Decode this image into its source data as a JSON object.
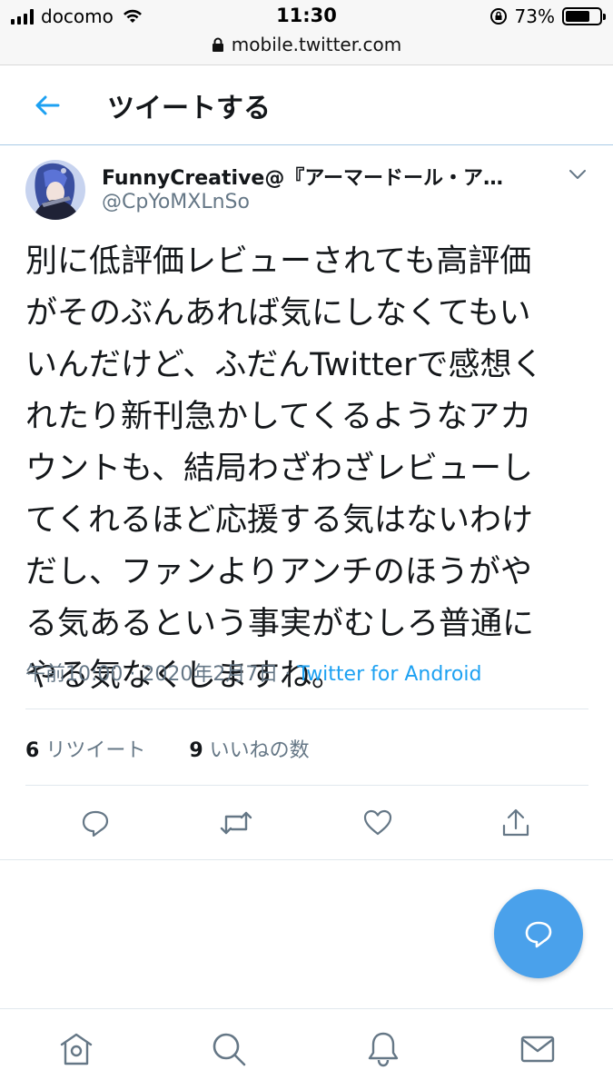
{
  "status_bar": {
    "carrier": "docomo",
    "time": "11:30",
    "battery": "73%",
    "battery_level": 0.73,
    "url": "mobile.twitter.com"
  },
  "header": {
    "title": "ツイートする"
  },
  "tweet": {
    "author_name": "FunnyCreative@『アーマードール・ア…",
    "author_handle": "@CpYoMXLnSo",
    "text_lines": [
      "別に低評価レビューされても高評価",
      "がそのぶんあれば気にしなくてもい",
      "いんだけど、ふだんTwitterで感想く",
      "れたり新刊急かしてくるようなアカ",
      "ウントも、結局わざわざレビューし",
      "てくれるほど応援する気はないわけ",
      "だし、ファンよりアンチのほうがや",
      "る気あるという事実がむしろ普通に",
      "やる気なくしますね。"
    ],
    "time": "午前10:00",
    "separator": "·",
    "date": "2020年2月7日",
    "source": "Twitter for Android",
    "retweet_count": "6",
    "retweet_label": "リツイート",
    "like_count": "9",
    "like_label": "いいねの数"
  },
  "icons": {
    "back": "arrow-left-icon",
    "caret": "chevron-down-icon",
    "reply": "reply-icon",
    "retweet": "retweet-icon",
    "like": "heart-icon",
    "share": "share-icon",
    "compose": "compose-icon",
    "home": "home-icon",
    "search": "search-icon",
    "notifications": "bell-icon",
    "messages": "envelope-icon"
  },
  "colors": {
    "accent": "#1da1f2",
    "fab": "#4aa1eb",
    "secondary_text": "#657786"
  }
}
